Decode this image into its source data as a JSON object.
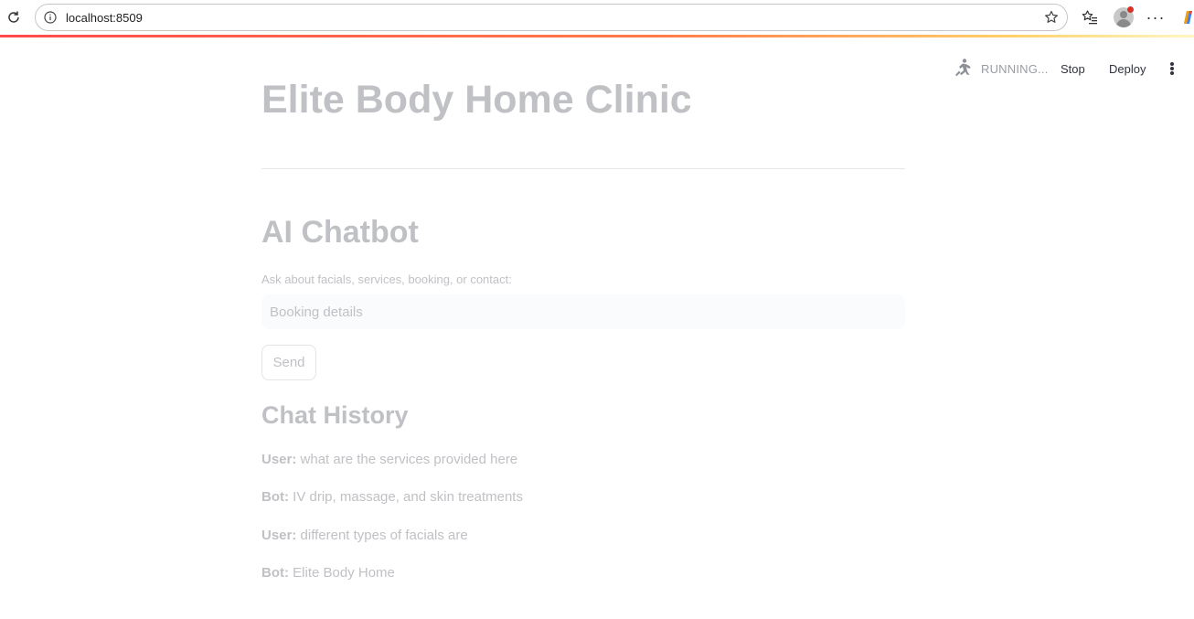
{
  "browser": {
    "url": "localhost:8509",
    "more_label": "···"
  },
  "app_header": {
    "status_text": "RUNNING...",
    "stop_label": "Stop",
    "deploy_label": "Deploy"
  },
  "main": {
    "title": "Elite Body Home Clinic",
    "section_title": "AI Chatbot",
    "input_label": "Ask about facials, services, booking, or contact:",
    "input_value": "Booking details",
    "send_label": "Send",
    "history_title": "Chat History",
    "chat_history": [
      {
        "speaker": "User:",
        "text": " what are the services provided here"
      },
      {
        "speaker": "Bot:",
        "text": " IV drip, massage, and skin treatments"
      },
      {
        "speaker": "User:",
        "text": " different types of facials are"
      },
      {
        "speaker": "Bot:",
        "text": " Elite Body Home"
      }
    ]
  },
  "colors": {
    "accent_red": "#ff4b4b",
    "stale_text": "#c0c1c5",
    "header_text": "#31333f",
    "notification_dot": "#d93025"
  }
}
